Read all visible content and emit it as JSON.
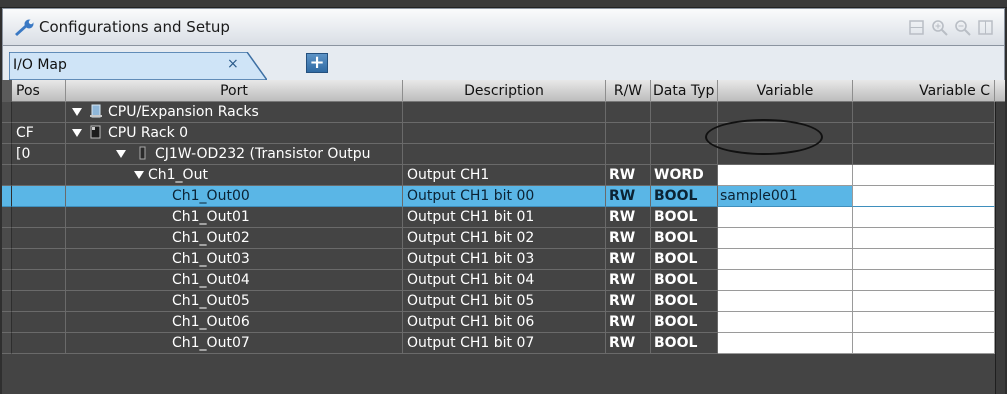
{
  "window": {
    "title": "Configurations and Setup",
    "tools": [
      "fit-icon",
      "zoom-in-icon",
      "zoom-out-icon",
      "fit-window-icon"
    ]
  },
  "tabs": [
    {
      "label": "I/O Map",
      "close": "×",
      "active": true
    }
  ],
  "add_tab_label": "+",
  "columns": {
    "pos": "Pos",
    "port": "Port",
    "description": "Description",
    "rw": "R/W",
    "datatype": "Data Typ",
    "variable": "Variable",
    "variable_comment": "Variable C"
  },
  "rows": [
    {
      "pos": "",
      "port": "CPU/Expansion Racks",
      "description": "",
      "rw": "",
      "type": "",
      "variable": "",
      "level": 1,
      "icon": "rack-icon"
    },
    {
      "pos": "CF",
      "port": "CPU Rack 0",
      "description": "",
      "rw": "",
      "type": "",
      "variable": "",
      "level": 2,
      "icon": "cpu-icon"
    },
    {
      "pos": "[0",
      "port": "CJ1W-OD232 (Transistor Outpu",
      "description": "",
      "rw": "",
      "type": "",
      "variable": "",
      "level": 3,
      "icon": "unit-icon"
    },
    {
      "pos": "",
      "port": "Ch1_Out",
      "description": "Output CH1",
      "rw": "RW",
      "type": "WORD",
      "variable": "",
      "level": 4
    },
    {
      "pos": "",
      "port": "Ch1_Out00",
      "description": "Output CH1 bit 00",
      "rw": "RW",
      "type": "BOOL",
      "variable": "sample001",
      "level": 5,
      "selected": true
    },
    {
      "pos": "",
      "port": "Ch1_Out01",
      "description": "Output CH1 bit 01",
      "rw": "RW",
      "type": "BOOL",
      "variable": "",
      "level": 5
    },
    {
      "pos": "",
      "port": "Ch1_Out02",
      "description": "Output CH1 bit 02",
      "rw": "RW",
      "type": "BOOL",
      "variable": "",
      "level": 5
    },
    {
      "pos": "",
      "port": "Ch1_Out03",
      "description": "Output CH1 bit 03",
      "rw": "RW",
      "type": "BOOL",
      "variable": "",
      "level": 5
    },
    {
      "pos": "",
      "port": "Ch1_Out04",
      "description": "Output CH1 bit 04",
      "rw": "RW",
      "type": "BOOL",
      "variable": "",
      "level": 5
    },
    {
      "pos": "",
      "port": "Ch1_Out05",
      "description": "Output CH1 bit 05",
      "rw": "RW",
      "type": "BOOL",
      "variable": "",
      "level": 5
    },
    {
      "pos": "",
      "port": "Ch1_Out06",
      "description": "Output CH1 bit 06",
      "rw": "RW",
      "type": "BOOL",
      "variable": "",
      "level": 5
    },
    {
      "pos": "",
      "port": "Ch1_Out07",
      "description": "Output CH1 bit 07",
      "rw": "RW",
      "type": "BOOL",
      "variable": "",
      "level": 5
    }
  ],
  "colors": {
    "grid_bg": "#444444",
    "selection": "#5ab6e6",
    "header": "#d0d0d0"
  }
}
